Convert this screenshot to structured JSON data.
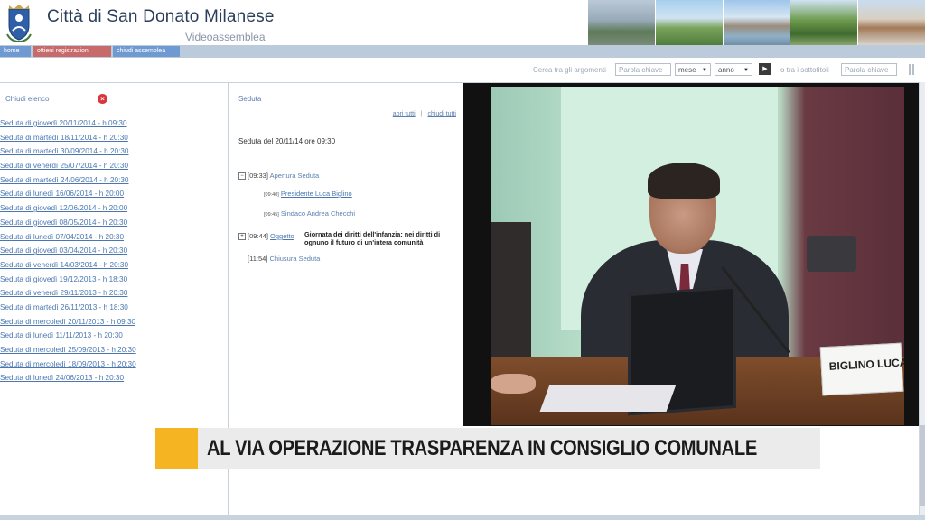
{
  "header": {
    "title": "Città di San Donato Milanese",
    "subtitle": "Videoassemblea"
  },
  "nav": {
    "home": "home",
    "register": "ottieni registrazioni",
    "close": "chiudi assemblea"
  },
  "search": {
    "label_topics": "Cerca tra gli argomenti",
    "keyword_placeholder": "Parola chiave",
    "month_select": "mese",
    "year_select": "anno",
    "label_subtopics": "o tra i sottotitoli",
    "subtitle_placeholder": "Parola chiave"
  },
  "left_panel": {
    "header": "Chiudi elenco",
    "sessions": [
      "Seduta di giovedì 20/11/2014 - h 09:30",
      "Seduta di martedì 18/11/2014 - h 20:30",
      "Seduta di martedì 30/09/2014 - h 20:30",
      "Seduta di venerdì 25/07/2014 - h 20:30",
      "Seduta di martedì 24/06/2014 - h 20:30",
      "Seduta di lunedì 16/06/2014 - h 20:00",
      "Seduta di giovedì 12/06/2014 - h 20:00",
      "Seduta di giovedì 08/05/2014 - h 20:30",
      "Seduta di lunedì 07/04/2014 - h 20:30",
      "Seduta di giovedì 03/04/2014 - h 20:30",
      "Seduta di venerdì 14/03/2014 - h 20:30",
      "Seduta di giovedì 19/12/2013 - h 18:30",
      "Seduta di venerdì 29/11/2013 - h 20:30",
      "Seduta di martedì 26/11/2013 - h 18:30",
      "Seduta di mercoledì 20/11/2013 - h 09:30",
      "Seduta di lunedì 11/11/2013 - h 20:30",
      "Seduta di mercoledì 25/09/2013 - h 20:30",
      "Seduta di mercoledì 18/09/2013 - h 20:30",
      "Seduta di lunedì 24/06/2013 - h 20:30"
    ]
  },
  "mid_panel": {
    "header": "Seduta",
    "open_all": "apri tutti",
    "close_all": "chiudi tutti",
    "session_date": "Seduta del 20/11/14 ore 09:30",
    "agenda": {
      "item1_time": "[09:33]",
      "item1_label": "Apertura Seduta",
      "sub1_time": "[09:40]",
      "sub1_label": "Presidente Luca Biglino",
      "sub2_time": "[09:45]",
      "sub2_label": "Sindaco Andrea Checchi",
      "item2_time": "[09:44]",
      "item2_label": "Oggetto",
      "item2_desc": "Giornata dei diritti dell'infanzia: nei diritti di ognuno il futuro di un'intera comunità",
      "item3_time": "[11:54]",
      "item3_label": "Chiusura Seduta"
    }
  },
  "video": {
    "nameplate": "BIGLINO LUCA"
  },
  "banner": {
    "headline": "AL VIA OPERAZIONE TRASPARENZA IN CONSIGLIO COMUNALE"
  },
  "colors": {
    "accent": "#f5b422",
    "link": "#4a77b0",
    "nav_blue": "#6f9ad1",
    "nav_red": "#c86a6a"
  }
}
